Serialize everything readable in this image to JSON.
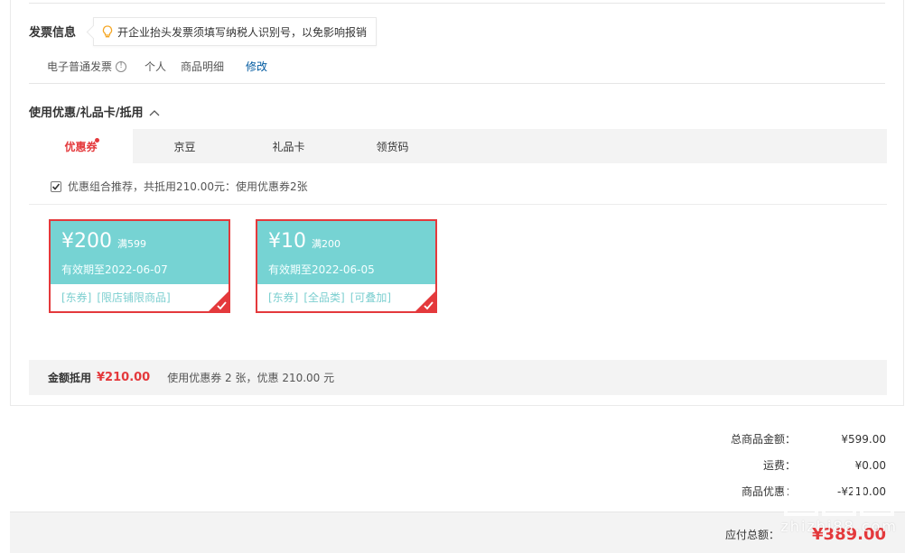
{
  "invoice": {
    "title": "发票信息",
    "tip": "开企业抬头发票须填写纳税人识别号，以免影响报销",
    "type": "电子普通发票",
    "title_type": "个人",
    "content": "商品明细",
    "edit": "修改"
  },
  "coupons_section": {
    "title": "使用优惠/礼品卡/抵用",
    "tabs": [
      {
        "label": "优惠券"
      },
      {
        "label": "京豆"
      },
      {
        "label": "礼品卡"
      },
      {
        "label": "领货码"
      }
    ],
    "combo_text": "优惠组合推荐，共抵用210.00元：使用优惠券2张",
    "coupons": [
      {
        "amount": "¥200",
        "condition": "满599",
        "valid": "有效期至2022-06-07",
        "tags": [
          "[东券]",
          "[限店铺限商品]"
        ]
      },
      {
        "amount": "¥10",
        "condition": "满200",
        "valid": "有效期至2022-06-05",
        "tags": [
          "[东券]",
          "[全品类]",
          "[可叠加]"
        ]
      }
    ],
    "summary_label": "金额抵用",
    "summary_value": "¥210.00",
    "summary_desc": "使用优惠券 2 张，优惠 210.00 元"
  },
  "totals": [
    {
      "label": "总商品金额：",
      "value": "¥599.00"
    },
    {
      "label": "运费：",
      "value": "¥0.00"
    },
    {
      "label": "商品优惠：",
      "value": "-¥210.00"
    }
  ],
  "payable": {
    "label": "应付总额：",
    "value": "¥389.00"
  },
  "watermark": {
    "text": "zhizhi88.com"
  },
  "colors": {
    "accent": "#e4393c",
    "coupon_bg": "#76d3d3",
    "link": "#005aa0"
  }
}
